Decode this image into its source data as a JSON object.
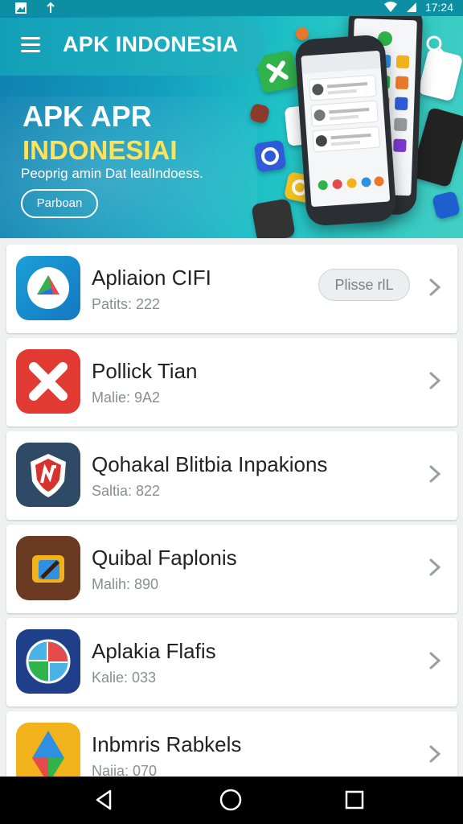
{
  "status_bar": {
    "time": "17:24"
  },
  "header": {
    "title": "APK INDONESIA"
  },
  "hero": {
    "title": "APK APR",
    "subtitle": "INDONESIAI",
    "tagline": "Peoprig amin Dat lealIndoess.",
    "button_label": "Parboan"
  },
  "apps": [
    {
      "name": "Apliaion CIFI",
      "meta": "Patits: 222",
      "action_label": "Plisse rlL"
    },
    {
      "name": "Pollick Tian",
      "meta": "Malie: 9A2"
    },
    {
      "name": "Qohakal Blitbia Inpakions",
      "meta": "Saltia: 822"
    },
    {
      "name": "Quibal Faplonis",
      "meta": "Malih: 890"
    },
    {
      "name": "Aplakia Flafis",
      "meta": "Kalie: 033"
    },
    {
      "name": "Inbmris Rabkels",
      "meta": "Naiia: 070"
    }
  ],
  "colors": {
    "accent": "#13a3bc",
    "hero_highlight": "#ffe25a",
    "card_bg": "#ffffff",
    "nav_bg": "#000000"
  },
  "icons": [
    "menu-icon",
    "search-icon",
    "chevron-right-icon",
    "back-icon",
    "home-icon",
    "recents-icon"
  ]
}
